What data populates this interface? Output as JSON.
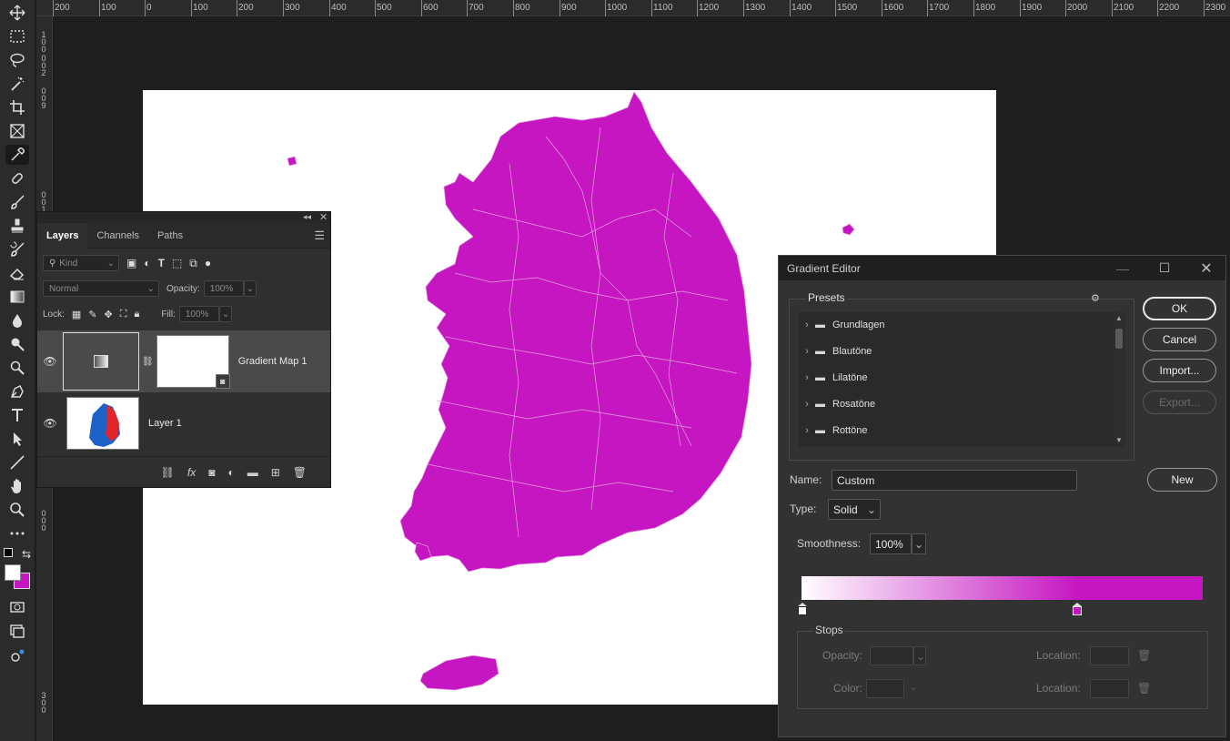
{
  "ruler": {
    "top_ticks": [
      "200",
      "100",
      "0",
      "100",
      "200",
      "300",
      "400",
      "500",
      "600",
      "700",
      "800",
      "900",
      "1000",
      "1100",
      "1200",
      "1300",
      "1400",
      "1500",
      "1600",
      "1700",
      "1800",
      "1900",
      "2000",
      "2100",
      "2200",
      "2300"
    ],
    "left_labels": [
      "1",
      "0",
      "0",
      "0",
      "0",
      "2",
      "0",
      "0",
      "9",
      "0",
      "0",
      "1",
      "0",
      "0",
      "0",
      "3",
      "0",
      "0"
    ]
  },
  "toolbar": {
    "tools": [
      "move-icon",
      "marquee-icon",
      "lasso-icon",
      "magic-wand-icon",
      "crop-icon",
      "frame-icon",
      "eyedropper-icon",
      "healing-brush-icon",
      "brush-icon",
      "clone-stamp-icon",
      "history-brush-icon",
      "eraser-icon",
      "gradient-icon",
      "blur-icon",
      "dodge-icon",
      "pen-icon",
      "type-icon",
      "path-selection-icon",
      "line-icon",
      "hand-icon",
      "zoom-icon",
      "more-icon"
    ],
    "foreground_color": "#ffffff",
    "background_color": "#c516c2"
  },
  "layers_panel": {
    "tabs": [
      "Layers",
      "Channels",
      "Paths"
    ],
    "filter_placeholder": "Kind",
    "blend_mode": "Normal",
    "opacity_label": "Opacity:",
    "opacity_value": "100%",
    "lock_label": "Lock:",
    "fill_label": "Fill:",
    "fill_value": "100%",
    "layers": [
      {
        "name": "Gradient Map 1"
      },
      {
        "name": "Layer 1"
      }
    ]
  },
  "gradient_editor": {
    "title": "Gradient Editor",
    "presets_label": "Presets",
    "presets": [
      "Grundlagen",
      "Blautöne",
      "Lilatöne",
      "Rosatöne",
      "Rottöne"
    ],
    "buttons": {
      "ok": "OK",
      "cancel": "Cancel",
      "import": "Import...",
      "export": "Export...",
      "new": "New"
    },
    "name_label": "Name:",
    "name_value": "Custom",
    "type_label": "Type:",
    "type_value": "Solid",
    "smoothness_label": "Smoothness:",
    "smoothness_value": "100%",
    "gradient_start_color": "#ffffff",
    "gradient_end_color": "#c516c2",
    "stops_label": "Stops",
    "stop_opacity_label": "Opacity:",
    "stop_color_label": "Color:",
    "location_label": "Location:",
    "location_label_2": "Location:"
  },
  "map_color": "#c516c2"
}
